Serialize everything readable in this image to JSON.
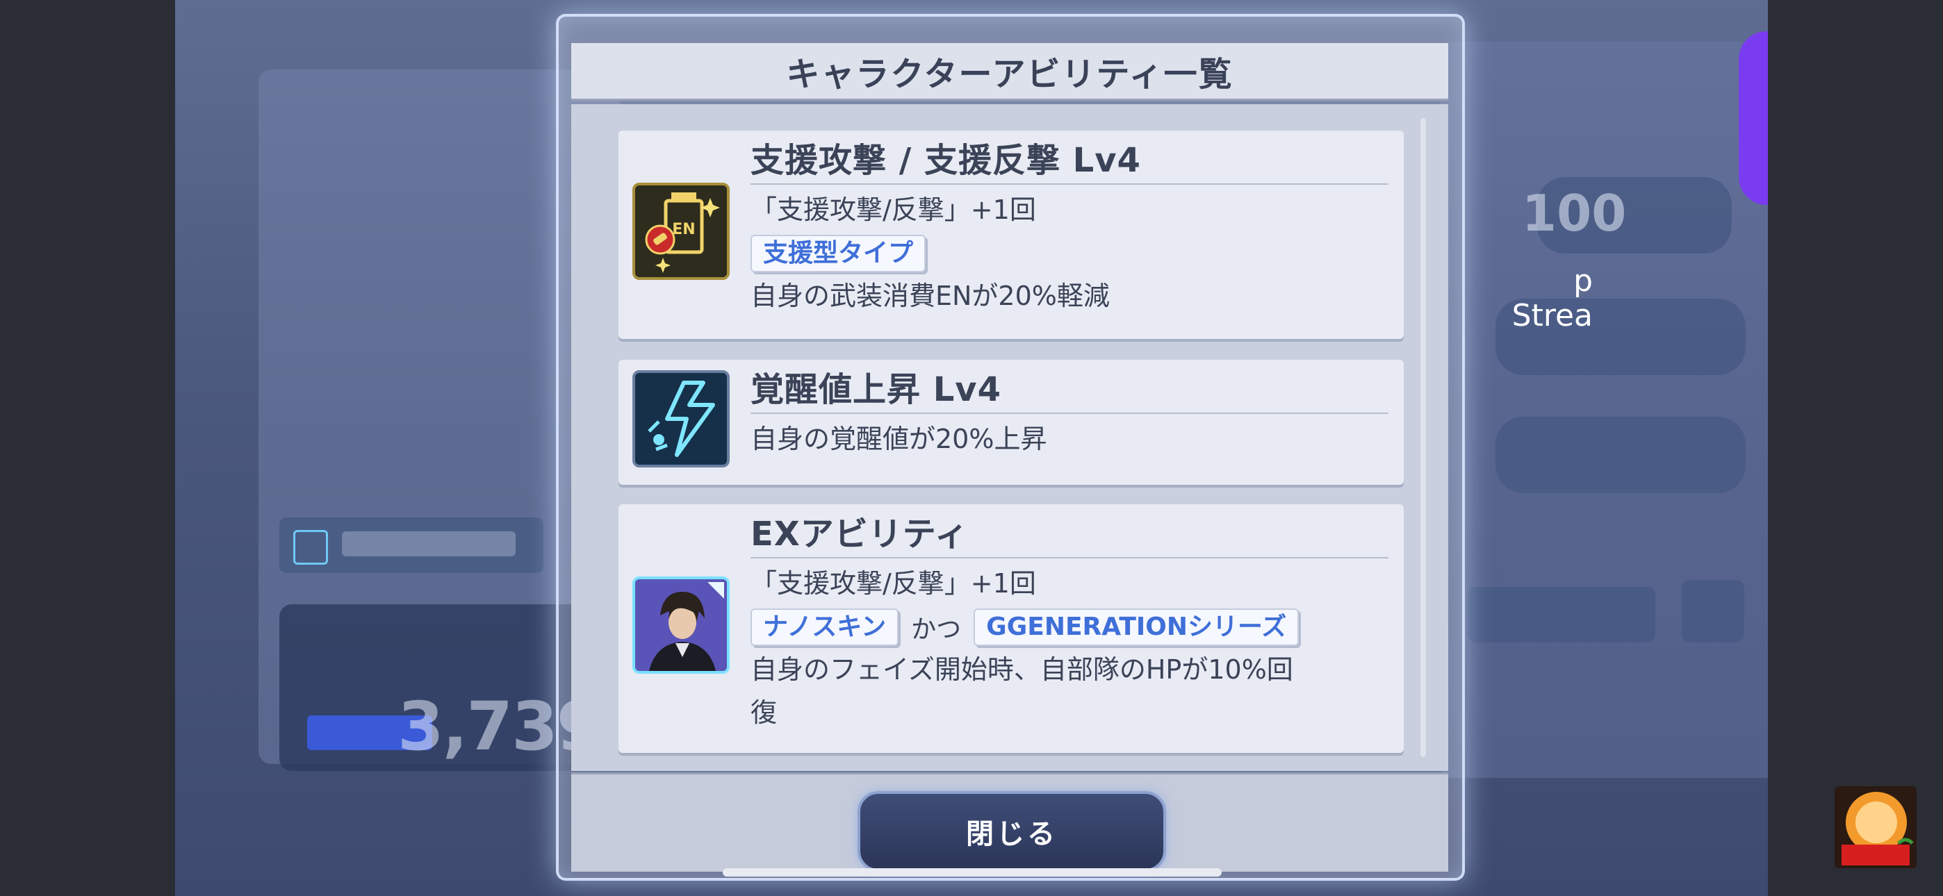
{
  "modal": {
    "title": "キャラクターアビリティ一覧",
    "close_label": "閉じる"
  },
  "abilities": [
    {
      "icon": "en-support-icon",
      "title": "支援攻撃 / 支援反撃 Lv4",
      "line1": "「支援攻撃/反撃」+1回",
      "tag": "支援型タイプ",
      "description": "自身の武装消費ENが20%軽減"
    },
    {
      "icon": "awakening-icon",
      "title": "覚醒値上昇 Lv4",
      "description": "自身の覚醒値が20%上昇"
    },
    {
      "icon": "character-portrait-icon",
      "title": "EXアビリティ",
      "line1": "「支援攻撃/反撃」+1回",
      "tag1": "ナノスキン",
      "connector": "かつ",
      "tag2": "GGENERATIONシリーズ",
      "description_line1": "自身のフェイズ開始時、自部隊のHPが10%回",
      "description_line2": "復"
    }
  ],
  "background": {
    "stat_value": "3,739",
    "level_value": "100",
    "stream_text": "p\nStrea"
  },
  "colors": {
    "tag_text": "#3f6fd8",
    "title_text": "#3b4358",
    "close_button": "#2b3558"
  }
}
